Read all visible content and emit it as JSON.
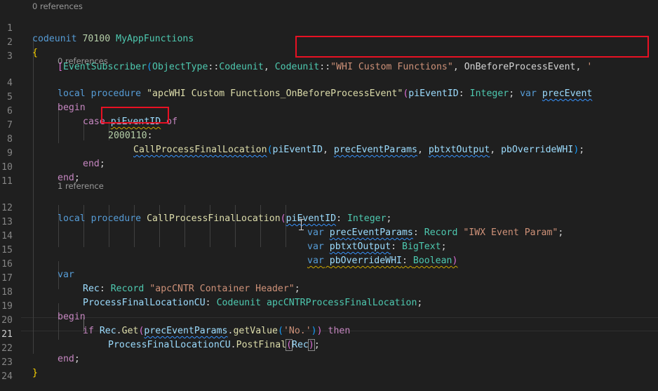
{
  "editor": {
    "codelens": {
      "codeunit_refs": "0 references",
      "event_refs": "0 references",
      "proc_refs": "1 reference"
    },
    "line_numbers": [
      "1",
      "2",
      "3",
      "4",
      "5",
      "6",
      "7",
      "8",
      "9",
      "10",
      "11",
      "12",
      "13",
      "14",
      "15",
      "16",
      "17",
      "18",
      "19",
      "20",
      "21",
      "22",
      "23",
      "24"
    ],
    "tokens": {
      "codeunit_kw": "codeunit",
      "codeunit_id": "70100",
      "codeunit_name": "MyAppFunctions",
      "open_brace": "{",
      "close_brace": "}",
      "attr_event_subscriber": "EventSubscriber",
      "object_type": "ObjectType",
      "codeunit_enum": "Codeunit",
      "codeunit_ref": "Codeunit",
      "whi_name": "\"WHI Custom Functions\"",
      "event_name": "OnBeforeProcessEvent",
      "local": "local",
      "procedure": "procedure",
      "proc1_name": "\"apcWHI Custom Functions_OnBeforeProcessEvent\"",
      "pi_event_id": "piEventID",
      "integer": "Integer",
      "var": "var",
      "prec_event_cut": "precEvent",
      "begin": "begin",
      "end": "end",
      "case": "case",
      "of": "of",
      "case_value": "2000110",
      "call_proc": "CallProcessFinalLocation",
      "prec_event_params": "precEventParams",
      "pbtxt_output": "pbtxtOutput",
      "pb_override": "pbOverrideWHI",
      "record": "Record",
      "iwx_event_param": "\"IWX Event Param\"",
      "bigtext": "BigText",
      "boolean": "Boolean",
      "rec": "Rec",
      "cntr_header": "\"apcCNTR Container Header\"",
      "pfl_cu": "ProcessFinalLocationCU",
      "codeunit_type": "Codeunit",
      "cntr_pfl": "apcCNTRProcessFinalLocation",
      "if": "if",
      "get": "Get",
      "get_value": "getValue",
      "no_str": "'No.'",
      "then": "then",
      "post_final": "PostFinal"
    }
  },
  "highlight_colors": {
    "annotation_box": "#e81123"
  }
}
